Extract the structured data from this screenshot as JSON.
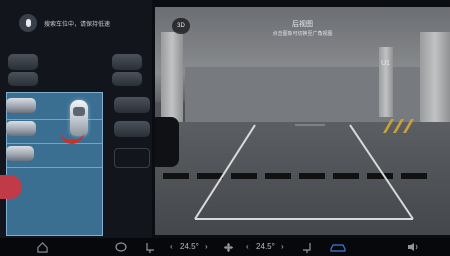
{
  "status": {
    "text": "搜索车位中，请保持低速"
  },
  "camera": {
    "mode_button": "3D",
    "title": "后视图",
    "subtitle": "点击图象可切换至广角视图",
    "pillar_label": "U1"
  },
  "bottom_bar": {
    "left_temp": "24.5°",
    "right_temp": "24.5°",
    "left_arrow_prev": "‹",
    "left_arrow_next": "›",
    "right_arrow_prev": "‹",
    "right_arrow_next": "›"
  },
  "colors": {
    "accent": "#3d7bd6",
    "selection": "#3a6f92",
    "warning": "#c8322d"
  }
}
